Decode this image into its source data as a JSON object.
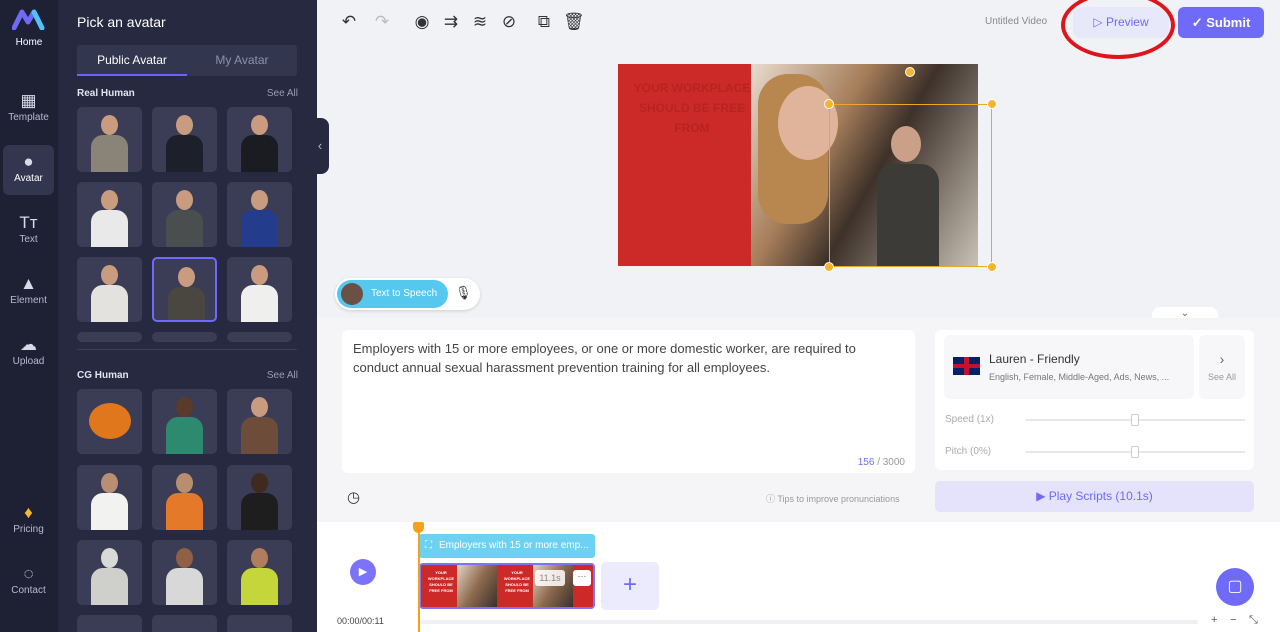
{
  "rail": {
    "logo_label": "Home",
    "items": [
      {
        "label": "Template",
        "icon": "template-icon"
      },
      {
        "label": "Avatar",
        "icon": "avatar-icon"
      },
      {
        "label": "Text",
        "icon": "text-icon"
      },
      {
        "label": "Element",
        "icon": "element-icon"
      },
      {
        "label": "Upload",
        "icon": "upload-icon"
      },
      {
        "label": "Pricing",
        "icon": "diamond-icon"
      },
      {
        "label": "Contact",
        "icon": "headset-icon"
      }
    ]
  },
  "panel": {
    "title": "Pick an avatar",
    "tabs": [
      "Public Avatar",
      "My Avatar"
    ],
    "sections": [
      {
        "label": "Real Human",
        "see_all": "See All"
      },
      {
        "label": "CG Human",
        "see_all": "See All"
      }
    ]
  },
  "topbar": {
    "video_title": "Untitled Video",
    "preview_label": "Preview",
    "submit_label": "Submit"
  },
  "canvas": {
    "red_text": "YOUR WORKPLACE SHOULD BE FREE FROM"
  },
  "tts": {
    "label": "Text to Speech"
  },
  "script": {
    "text": "Employers with 15 or more employees, or one or more domestic worker, are required to conduct annual sexual harassment prevention training for all employees.",
    "char_count": "156",
    "char_limit": "/ 3000",
    "tips": "Tips to improve pronunciations"
  },
  "voice": {
    "name": "Lauren - Friendly",
    "description": "English, Female, Middle-Aged, Ads, News, ...",
    "see_all": "See All",
    "speed_label": "Speed (1x)",
    "pitch_label": "Pitch (0%)",
    "play_label": "Play Scripts (10.1s)"
  },
  "timeline": {
    "current_time": "00:00/00:11",
    "clip_label": "Employers with 15 or more emp...",
    "clip_duration": "11.1s",
    "thumb_text": "YOUR WORKPLACE SHOULD BE FREE FROM"
  },
  "colors": {
    "accent": "#6f6af8",
    "rail_bg": "#1e2033",
    "panel_bg": "#262940",
    "canvas_red": "#cc2a28",
    "annotation_circle": "#e0141b"
  }
}
